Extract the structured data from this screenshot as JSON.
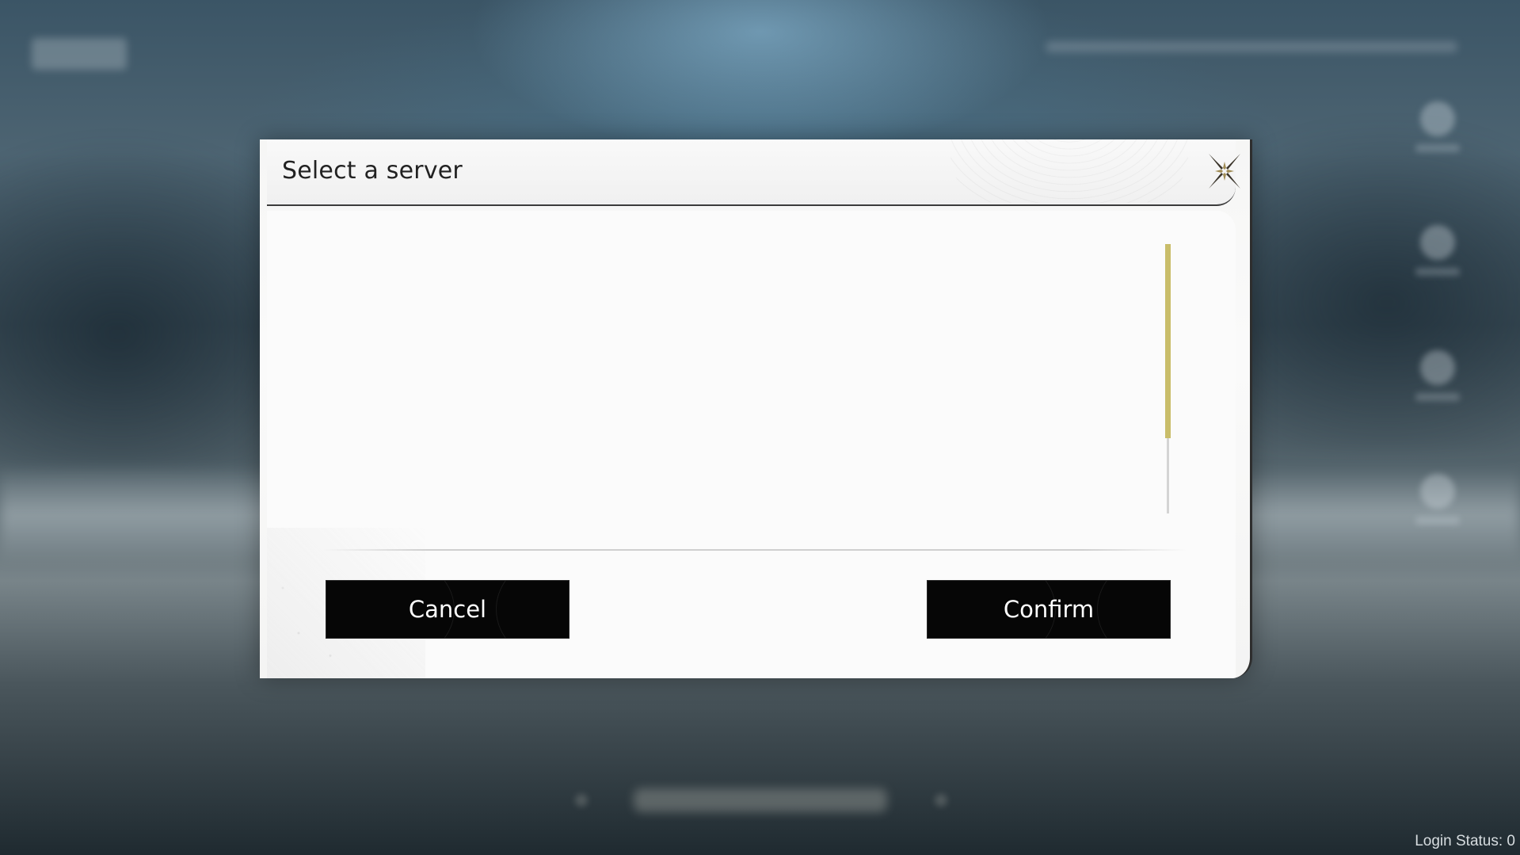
{
  "background": {
    "login_status": "Login Status: 0"
  },
  "dialog": {
    "title": "Select a server",
    "close_icon": "close-x-icon",
    "server_list": [],
    "scrollbar": {
      "position": 0.0,
      "visible_fraction": 0.72
    },
    "buttons": {
      "cancel_label": "Cancel",
      "confirm_label": "Confirm"
    }
  },
  "colors": {
    "accent_scroll": "#c9bd6a",
    "button_bg": "#060606",
    "dialog_bg": "#fafafa"
  }
}
